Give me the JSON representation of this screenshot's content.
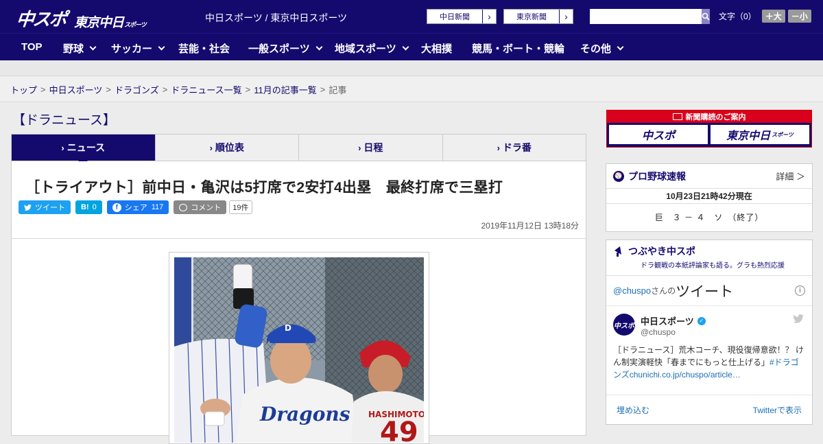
{
  "header": {
    "logo_main": "中スポ",
    "logo_tokyo": "東京中日",
    "logo_tokyo_small": "スポーツ",
    "site_links": "中日スポーツ / 東京中日スポーツ",
    "paper_links": [
      "中日新聞",
      "東京新聞"
    ],
    "search_placeholder": "",
    "fontsize_label": "文字（0）",
    "fontsize_bigger": "＋大",
    "fontsize_smaller": "－小"
  },
  "nav": [
    {
      "label": "TOP",
      "dropdown": false
    },
    {
      "label": "野球",
      "dropdown": true
    },
    {
      "label": "サッカー",
      "dropdown": true
    },
    {
      "label": "芸能・社会",
      "dropdown": false
    },
    {
      "label": "一般スポーツ",
      "dropdown": true
    },
    {
      "label": "地域スポーツ",
      "dropdown": true
    },
    {
      "label": "大相撲",
      "dropdown": false
    },
    {
      "label": "競馬・ボート・競輪",
      "dropdown": false
    },
    {
      "label": "その他",
      "dropdown": true
    }
  ],
  "breadcrumb": [
    "トップ",
    "中日スポーツ",
    "ドラゴンズ",
    "ドラニュース一覧",
    "11月の記事一覧",
    "記事"
  ],
  "section_title": "【ドラニュース】",
  "tabs": [
    "ニュース",
    "順位表",
    "日程",
    "ドラ番"
  ],
  "article": {
    "headline": "［トライアウト］前中日・亀沢は5打席で2安打4出塁　最終打席で三塁打",
    "social": {
      "tweet": "ツイート",
      "hatena": "B!",
      "hatena_count": "0",
      "share": "シェア",
      "share_count": "117",
      "comment": "コメント",
      "comment_count": "19件"
    },
    "date": "2019年11月12日 13時18分"
  },
  "sidebar": {
    "banner_top": "新聞購読のご案内",
    "banner_left": "中スポ",
    "banner_right": "東京中日",
    "banner_right_small": "スポーツ",
    "baseball": {
      "title": "プロ野球速報",
      "more": "詳細 ＞",
      "time": "10月23日21時42分現在",
      "score": "巨　３ － ４　ソ　（終了）"
    },
    "tweets": {
      "title": "つぶやき中スポ",
      "subtitle": "ドラ観戦の本紙評論家も語る。グラも熱烈応援",
      "handle_prefix": "@chuspo",
      "handle_suffix": "さんの",
      "handle_big": "ツイート",
      "info": "i",
      "name": "中日スポーツ",
      "handle": "@chuspo",
      "avatar": "中スポ",
      "text_plain": "［ドラニュース］荒木コーチ、現役復帰意欲！？ けん制実演軽快「春までにもっと仕上げる」",
      "text_link": "#ドラゴンズchunichi.co.jp/chuspo/article…",
      "embed": "埋め込む",
      "view_on": "Twitterで表示"
    }
  },
  "colors": {
    "brand_navy": "#140a6e",
    "banner_red": "#d8001c",
    "twitter_blue": "#1da1f2",
    "hatena_blue": "#00a4de",
    "facebook_blue": "#1877f2",
    "comment_grey": "#888888"
  }
}
